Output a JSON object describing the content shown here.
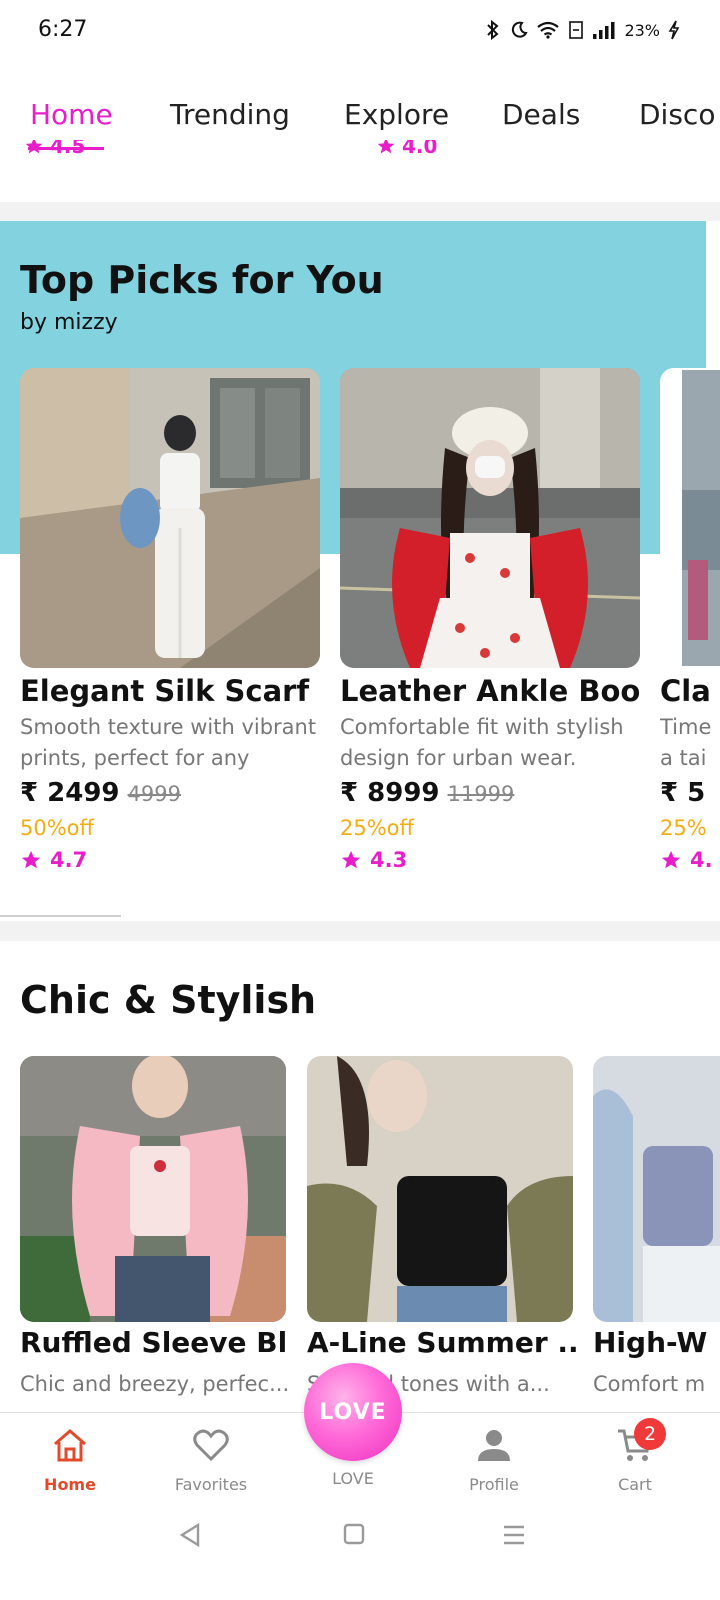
{
  "status_bar": {
    "time": "6:27",
    "battery": "23%"
  },
  "top_tabs": [
    "Home",
    "Trending",
    "Explore",
    "Deals",
    "Disco"
  ],
  "peek_ratings": [
    "4.5",
    "4.0"
  ],
  "top_picks": {
    "title": "Top Picks for You",
    "subtitle": "by mizzy",
    "cards": [
      {
        "name": "Elegant Silk Scarf",
        "desc": "Smooth texture with vibrant prints, perfect for any seas...",
        "price": "₹ 2499",
        "old_price": "4999",
        "discount": "50%off",
        "rating": "4.7"
      },
      {
        "name": "Leather Ankle Boots",
        "desc": "Comfortable fit with stylish design for urban wear.",
        "price": "₹ 8999",
        "old_price": "11999",
        "discount": "25%off",
        "rating": "4.3"
      },
      {
        "name": "Cla",
        "desc": "Time a tai",
        "price": "₹ 5",
        "old_price": "",
        "discount": "25%",
        "rating": "4."
      }
    ]
  },
  "chic": {
    "title": "Chic & Stylish",
    "cards": [
      {
        "name": "Ruffled Sleeve Bl...",
        "desc": "Chic and breezy, perfec..."
      },
      {
        "name": "A-Line Summer ...",
        "desc": "S       tel tones with a..."
      },
      {
        "name": "High-W",
        "desc": "Comfort m"
      }
    ]
  },
  "bottom_nav": {
    "items": [
      "Home",
      "Favorites",
      "LOVE",
      "Profile",
      "Cart"
    ],
    "love_button": "LOVE",
    "cart_badge": "2"
  },
  "colors": {
    "accent": "#e91ecb",
    "teal": "#82d3df",
    "discount": "#f0ae12",
    "nav_active": "#e04b2c"
  }
}
